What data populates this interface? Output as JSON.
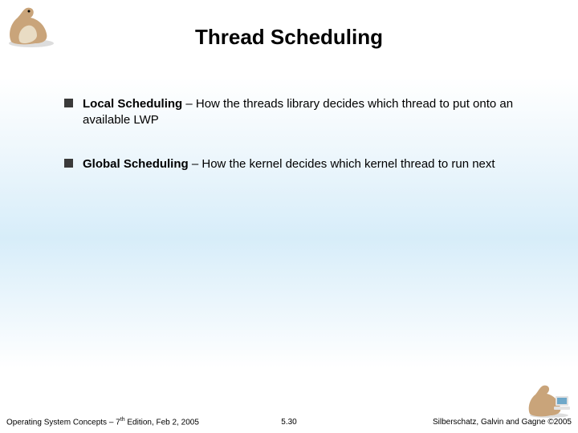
{
  "title": "Thread Scheduling",
  "bullets": [
    {
      "lead": "Local Scheduling",
      "rest": " – How the threads library decides which thread to put onto an available LWP"
    },
    {
      "lead": "Global Scheduling",
      "rest": " – How the kernel decides which kernel thread to run next"
    }
  ],
  "footer": {
    "left_a": "Operating System Concepts – 7",
    "left_sup": "th",
    "left_b": " Edition, Feb 2, 2005",
    "center": "5.30",
    "right": "Silberschatz, Galvin and Gagne ©2005"
  },
  "logo_colors": {
    "body": "#c9a47a",
    "shadow": "#a37e54",
    "belly": "#e9dcc4",
    "monitor": "#6fa8c9",
    "case": "#e2e2e2"
  }
}
